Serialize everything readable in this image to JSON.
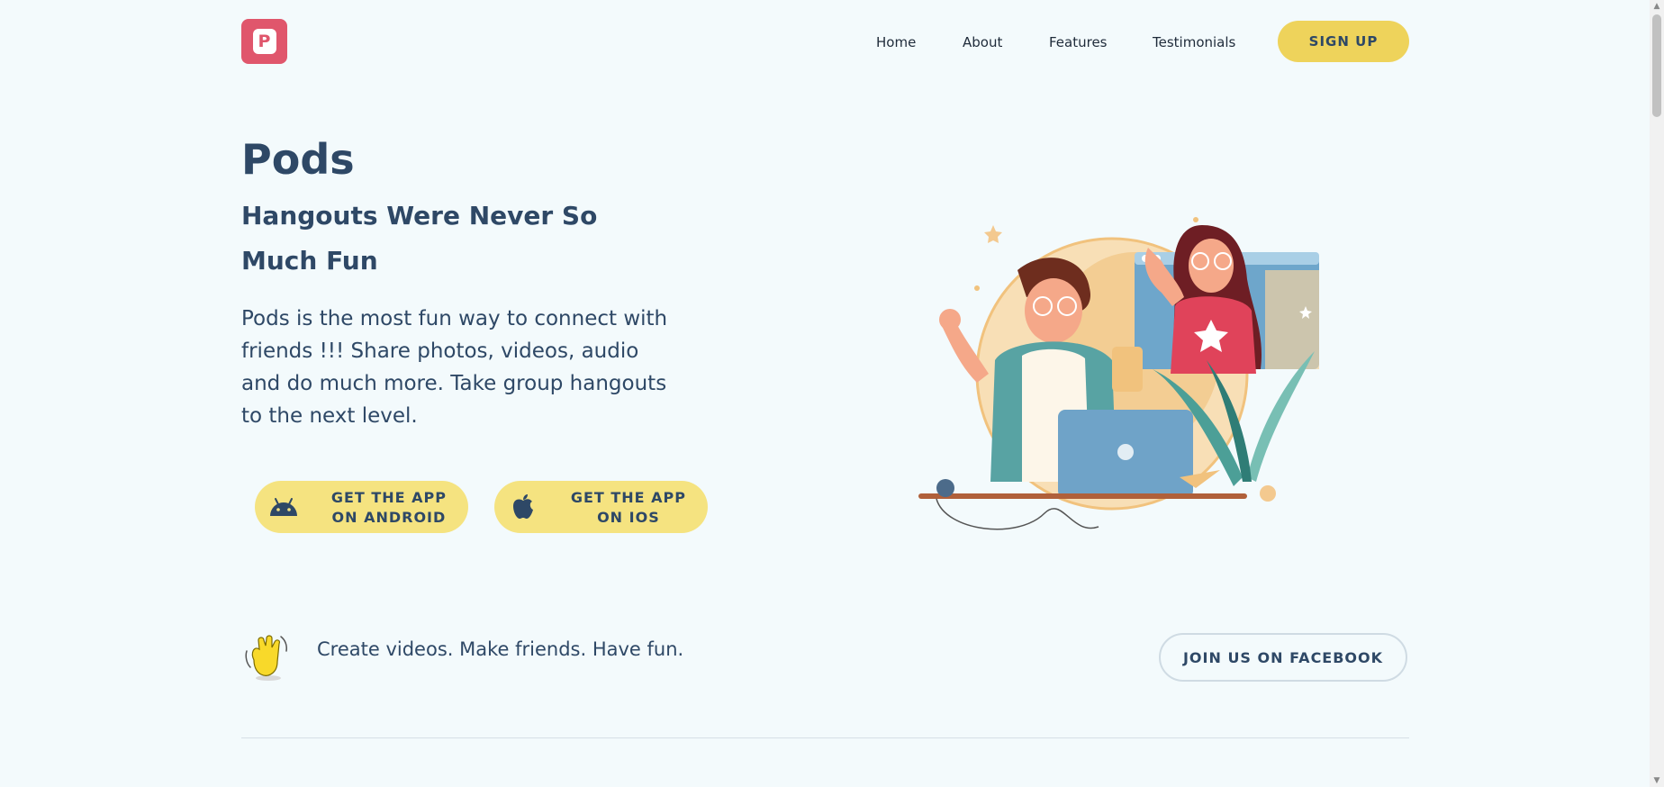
{
  "brand": {
    "logo_letter": "P",
    "accent": "#e0566c"
  },
  "nav": {
    "items": [
      {
        "label": "Home"
      },
      {
        "label": "About"
      },
      {
        "label": "Features"
      },
      {
        "label": "Testimonials"
      }
    ],
    "signup_label": "SIGN UP"
  },
  "hero": {
    "title": "Pods",
    "subtitle": "Hangouts Were Never So Much Fun",
    "description": "Pods is the most fun way to connect with friends !!! Share photos, videos, audio and do much more. Take group hangouts to the next level.",
    "android_button": {
      "line1": "GET THE APP",
      "line2": "ON ANDROID",
      "icon": "android-icon"
    },
    "ios_button": {
      "line1": "GET THE APP",
      "line2": "ON IOS",
      "icon": "apple-icon"
    }
  },
  "strip": {
    "icon": "waving-hand-icon",
    "tagline": "Create videos. Make friends. Have fun.",
    "facebook_label": "JOIN US ON FACEBOOK"
  },
  "colors": {
    "background": "#f3fafc",
    "text": "#2e4866",
    "button_yellow": "#eed35b",
    "store_yellow": "#f5e380"
  }
}
